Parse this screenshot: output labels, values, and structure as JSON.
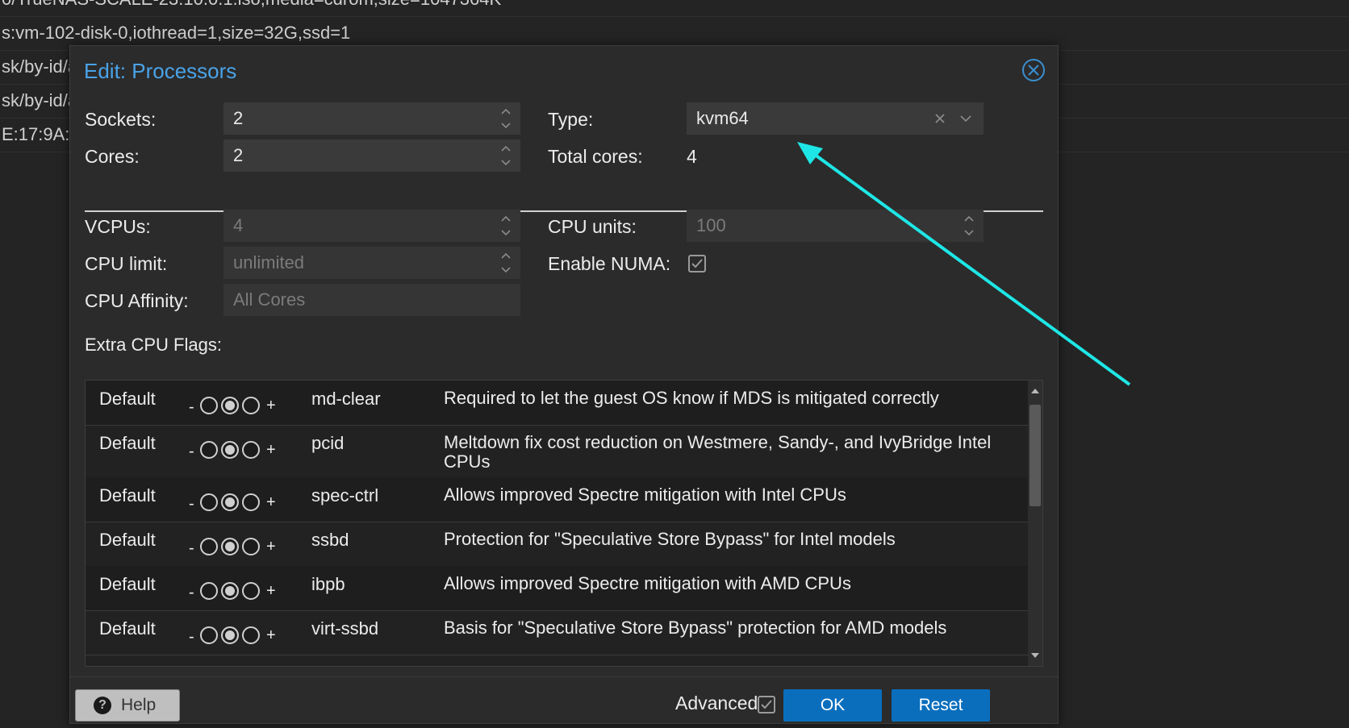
{
  "background_rows": [
    "0/TrueNAS-SCALE-23.10.0.1.iso,media=cdrom,size=1047364K",
    "s:vm-102-disk-0,iothread=1,size=32G,ssd=1",
    "sk/by-id/a",
    "sk/by-id/a",
    "E:17:9A:"
  ],
  "dialog": {
    "title": "Edit: Processors",
    "sockets_label": "Sockets:",
    "sockets_value": "2",
    "cores_label": "Cores:",
    "cores_value": "2",
    "type_label": "Type:",
    "type_value": "kvm64",
    "total_cores_label": "Total cores:",
    "total_cores_value": "4",
    "vcpus_label": "VCPUs:",
    "vcpus_value": "4",
    "cpu_units_label": "CPU units:",
    "cpu_units_value": "100",
    "cpu_limit_label": "CPU limit:",
    "cpu_limit_value": "unlimited",
    "enable_numa_label": "Enable NUMA:",
    "enable_numa_checked": true,
    "cpu_affinity_label": "CPU Affinity:",
    "cpu_affinity_value": "All Cores",
    "extra_flags_label": "Extra CPU Flags:",
    "flags": [
      {
        "state": "Default",
        "minus": "-",
        "plus": "+",
        "name": "md-clear",
        "desc": "Required to let the guest OS know if MDS is mitigated correctly"
      },
      {
        "state": "Default",
        "minus": "-",
        "plus": "+",
        "name": "pcid",
        "desc": "Meltdown fix cost reduction on Westmere, Sandy-, and IvyBridge Intel CPUs"
      },
      {
        "state": "Default",
        "minus": "-",
        "plus": "+",
        "name": "spec-ctrl",
        "desc": "Allows improved Spectre mitigation with Intel CPUs"
      },
      {
        "state": "Default",
        "minus": "-",
        "plus": "+",
        "name": "ssbd",
        "desc": "Protection for \"Speculative Store Bypass\" for Intel models"
      },
      {
        "state": "Default",
        "minus": "-",
        "plus": "+",
        "name": "ibpb",
        "desc": "Allows improved Spectre mitigation with AMD CPUs"
      },
      {
        "state": "Default",
        "minus": "-",
        "plus": "+",
        "name": "virt-ssbd",
        "desc": "Basis for \"Speculative Store Bypass\" protection for AMD models"
      }
    ],
    "help_label": "Help",
    "advanced_label": "Advanced",
    "advanced_checked": true,
    "ok_label": "OK",
    "reset_label": "Reset"
  },
  "colors": {
    "accent": "#0a6ebd",
    "title": "#4aa3e8",
    "annotation_arrow": "#1ee6e6"
  }
}
